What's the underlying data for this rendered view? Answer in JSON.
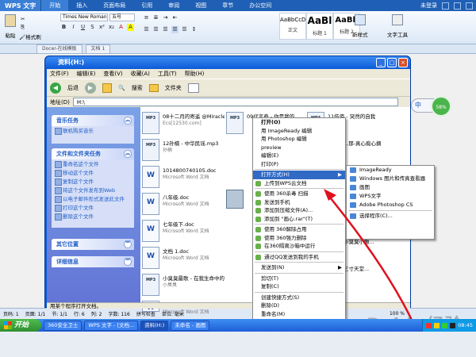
{
  "wps": {
    "brand": "WPS 文字",
    "tabs": [
      "开始",
      "插入",
      "页面布局",
      "引用",
      "审阅",
      "视图",
      "章节",
      "办公空间"
    ],
    "user": "未登录",
    "ribbon": {
      "paste": "粘贴",
      "format_painter": "格式刷",
      "font": "Times New Roman",
      "size": "五号",
      "styles": [
        {
          "sample": "AaBbCcDd",
          "name": "正文"
        },
        {
          "sample": "AaBl",
          "name": "标题 1"
        },
        {
          "sample": "AaBb",
          "name": "标题 2"
        }
      ],
      "new_style": "新样式",
      "text_tools": "文字工具"
    },
    "doc_tabs": [
      "Docer-在线模板",
      "文档 1"
    ],
    "statusbar": {
      "page": "页码: 1",
      "pages": "页面: 1/1",
      "section": "节: 1/1",
      "row": "行: 6",
      "col": "列: 2",
      "words": "字数: 116",
      "spell": "拼写检查",
      "unit": "单位: 毫米",
      "zoom": "100 %"
    }
  },
  "explorer": {
    "title": "资料(H:)",
    "menu": [
      "文件(F)",
      "编辑(E)",
      "查看(V)",
      "收藏(A)",
      "工具(T)",
      "帮助(H)"
    ],
    "toolbar": {
      "back": "后退",
      "search": "搜索",
      "folders": "文件夹"
    },
    "address_label": "地址(D)",
    "address": "H:\\",
    "tasks": {
      "music_header": "音乐任务",
      "music_items": [
        "联机购买音乐"
      ],
      "file_header": "文件和文件夹任务",
      "file_items": [
        "重命名这个文件",
        "移动这个文件",
        "复制这个文件",
        "将这个文件发布到Web",
        "以电子邮件形式发送此文件",
        "打印这个文件",
        "删除这个文件"
      ],
      "other_header": "其它位置",
      "details_header": "详细信息"
    },
    "files": [
      {
        "name": "08十二月的寄遥 @Miracles In D...",
        "meta": "Ecs[12530.com]",
        "type": "MP3"
      },
      {
        "name": "12孙楠 - 中华民谣.mp3",
        "meta": "孙楠",
        "type": "MP3"
      },
      {
        "name": "1014800740105.doc",
        "meta": "Microsoft Word 文档",
        "type": "DOC"
      },
      {
        "name": "八年级.doc",
        "meta": "Microsoft Word 文档",
        "type": "DOC"
      },
      {
        "name": "七年级下.doc",
        "meta": "Microsoft Word 文档",
        "type": "DOC"
      },
      {
        "name": "文档 1.doc",
        "meta": "Microsoft Word 文档",
        "type": "DOC"
      },
      {
        "name": "小臭臭最歌 - 在我生命中的每一天.mp3",
        "meta": "小臭臭",
        "type": "MP3"
      },
      {
        "name": "主办单位.doc",
        "meta": "Microsoft Word 文档",
        "type": "DOC"
      },
      {
        "name": "09代言奇 - 你是我的...",
        "meta": "",
        "type": "MP3"
      },
      {
        "name": "11伍佰 - 突然的自我",
        "meta": "",
        "type": "MP3"
      },
      {
        "name": "...那-真心痴心摘",
        "meta": "",
        "type": "MP3"
      },
      {
        "name": "...ZRK.doc",
        "meta": "Microsoft Word 文档",
        "type": "DOC"
      },
      {
        "name": "小臭臭小鳅...",
        "meta": "",
        "type": "DOC"
      },
      {
        "name": "三寸天堂...",
        "meta": "",
        "type": "MP3"
      }
    ],
    "status": "用某个程序打开文档。"
  },
  "context_menu": [
    {
      "label": "打开(O)",
      "bold": true
    },
    {
      "label": "用 ImageReady 编辑"
    },
    {
      "label": "用 Photoshop 编辑"
    },
    {
      "label": "preview"
    },
    {
      "label": "编辑(E)"
    },
    {
      "label": "打印(P)"
    },
    {
      "sep": true
    },
    {
      "label": "打开方式(H)",
      "sub": true,
      "highlight": true
    },
    {
      "label": "上传到WPS云文档",
      "icon": true
    },
    {
      "sep": true
    },
    {
      "label": "使用 360杀毒 扫描",
      "icon": true
    },
    {
      "label": "发送到手机",
      "icon": true
    },
    {
      "label": "添加到压缩文件(A)...",
      "icon": true
    },
    {
      "label": "添加到 \"画心.rar\"(T)",
      "icon": true
    },
    {
      "sep": true
    },
    {
      "label": "使用 360解除占用",
      "icon": true
    },
    {
      "label": "使用 360强力删除",
      "icon": true
    },
    {
      "label": "在360隔离沙箱中运行",
      "icon": true
    },
    {
      "sep": true
    },
    {
      "label": "通过QQ发送到我的手机",
      "icon": true
    },
    {
      "sep": true
    },
    {
      "label": "发送到(N)",
      "sub": true
    },
    {
      "sep": true
    },
    {
      "label": "剪切(T)"
    },
    {
      "label": "复制(C)"
    },
    {
      "sep": true
    },
    {
      "label": "创建快捷方式(S)"
    },
    {
      "label": "删除(D)"
    },
    {
      "label": "重命名(M)"
    },
    {
      "sep": true
    },
    {
      "label": "属性(R)"
    }
  ],
  "open_with": [
    "ImageReady",
    "Windows 图片和传真查看器",
    "画图",
    "WPS文字",
    "Adobe Photoshop CS",
    "选择程序(C)..."
  ],
  "taskbar": {
    "start": "开始",
    "tasks": [
      "360安全卫士",
      "WPS 文字 - [文档...",
      "资料(H:)",
      "未命名 - 画图"
    ],
    "time": "08:45"
  },
  "ime": "中",
  "net_ball": "58%",
  "watermark": "Baidu经验",
  "colors": {
    "xp_blue": "#0b5ad8",
    "wps_blue": "#1f5fb5",
    "highlight": "#316ac5",
    "arrow": "#e0101e"
  }
}
